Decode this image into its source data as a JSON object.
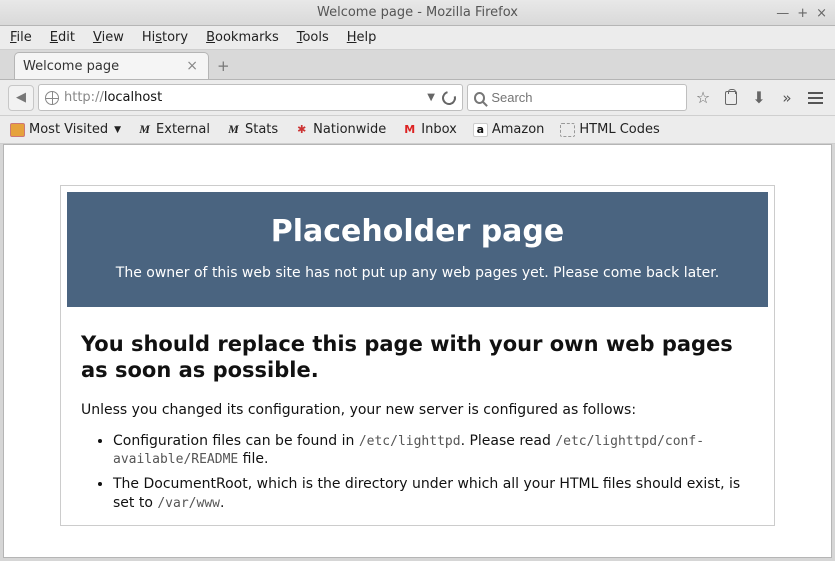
{
  "window": {
    "title": "Welcome page - Mozilla Firefox",
    "minimize": "—",
    "maximize": "+",
    "close": "×"
  },
  "menubar": {
    "file": "File",
    "edit": "Edit",
    "view": "View",
    "history": "History",
    "bookmarks": "Bookmarks",
    "tools": "Tools",
    "help": "Help"
  },
  "tab": {
    "label": "Welcome page"
  },
  "url": {
    "prefix": "http://",
    "host": "localhost"
  },
  "search": {
    "placeholder": "Search"
  },
  "bookmarks": {
    "most_visited": "Most Visited",
    "external": "External",
    "stats": "Stats",
    "nationwide": "Nationwide",
    "inbox": "Inbox",
    "amazon": "Amazon",
    "html_codes": "HTML Codes"
  },
  "page": {
    "banner_title": "Placeholder page",
    "banner_sub": "The owner of this web site has not put up any web pages yet. Please come back later.",
    "h2": "You should replace this page with your own web pages as soon as possible.",
    "intro": "Unless you changed its configuration, your new server is configured as follows:",
    "li1a": "Configuration files can be found in ",
    "li1_code1": "/etc/lighttpd",
    "li1b": ". Please read ",
    "li1_code2": "/etc/lighttpd/conf-available/README",
    "li1c": " file.",
    "li2a": "The DocumentRoot, which is the directory under which all your HTML files should exist, is set to ",
    "li2_code": "/var/www",
    "li2b": "."
  }
}
